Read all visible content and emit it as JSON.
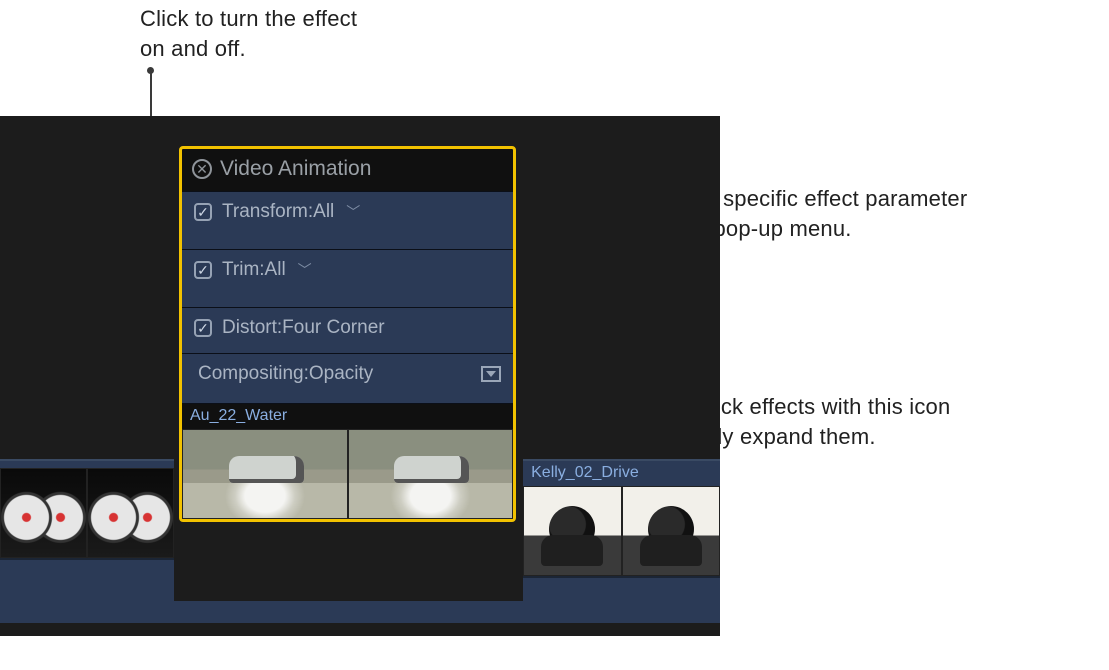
{
  "callouts": {
    "topLeft": "Click to turn the effect on and off.",
    "right1": "Choose a specific effect parameter from this pop-up menu.",
    "right2": "Double-click effects with this icon to vertically expand them."
  },
  "popover": {
    "title": "Video Animation",
    "rows": {
      "r0": {
        "label": "Transform:All",
        "hasCheck": true,
        "hasChevron": true
      },
      "r1": {
        "label": "Trim:All",
        "hasCheck": true,
        "hasChevron": true
      },
      "r2": {
        "label": "Distort:Four Corner",
        "hasCheck": true,
        "hasChevron": false
      },
      "r3": {
        "label": "Compositing:Opacity",
        "hasCheck": false,
        "hasChevron": false,
        "hasExpand": true
      }
    }
  },
  "clips": {
    "left": {
      "label": ""
    },
    "mid": {
      "label": "Au_22_Water"
    },
    "right": {
      "label": "Kelly_02_Drive"
    }
  }
}
